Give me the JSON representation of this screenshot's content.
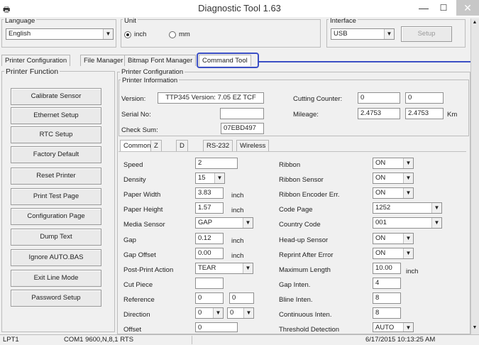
{
  "window": {
    "title": "Diagnostic Tool 1.63",
    "minimize": "—",
    "maximize": "☐",
    "close": "✕",
    "icon": "printer-icon"
  },
  "language": {
    "label": "Language",
    "value": "English"
  },
  "unit": {
    "label": "Unit",
    "options": [
      "inch",
      "mm"
    ],
    "selected": "inch"
  },
  "interface": {
    "label": "Interface",
    "value": "USB",
    "setup_label": "Setup"
  },
  "main_tabs": [
    "Printer Configuration",
    "File Manager",
    "Bitmap Font Manager",
    "Command Tool"
  ],
  "printer_function": {
    "label": "Printer Function",
    "buttons": [
      "Calibrate Sensor",
      "Ethernet Setup",
      "RTC Setup",
      "Factory Default",
      "Reset Printer",
      "Print Test Page",
      "Configuration Page",
      "Dump Text",
      "Ignore AUTO.BAS",
      "Exit Line Mode",
      "Password Setup"
    ]
  },
  "printer_configuration": {
    "label": "Printer Configuration",
    "info_label": "Printer Information",
    "version_label": "Version:",
    "version": "TTP345 Version: 7.05 EZ TCF",
    "serial_label": "Serial No:",
    "serial": "",
    "checksum_label": "Check Sum:",
    "checksum": "07EBD497",
    "cutting_counter_label": "Cutting Counter:",
    "cutting_counter": [
      "0",
      "0"
    ],
    "mileage_label": "Mileage:",
    "mileage": [
      "2.4753",
      "2.4753"
    ],
    "mileage_unit": "Km"
  },
  "sub_tabs": [
    "Common",
    "Z",
    "D",
    "RS-232",
    "Wireless"
  ],
  "common": {
    "speed": {
      "label": "Speed",
      "value": "2"
    },
    "density": {
      "label": "Density",
      "value": "15"
    },
    "paper_width": {
      "label": "Paper Width",
      "value": "3.83",
      "unit": "inch"
    },
    "paper_height": {
      "label": "Paper Height",
      "value": "1.57",
      "unit": "inch"
    },
    "media_sensor": {
      "label": "Media Sensor",
      "value": "GAP"
    },
    "gap": {
      "label": "Gap",
      "value": "0.12",
      "unit": "inch"
    },
    "gap_offset": {
      "label": "Gap Offset",
      "value": "0.00",
      "unit": "inch"
    },
    "post_print_action": {
      "label": "Post-Print Action",
      "value": "TEAR"
    },
    "cut_piece": {
      "label": "Cut Piece",
      "value": ""
    },
    "reference": {
      "label": "Reference",
      "x": "0",
      "y": "0"
    },
    "direction": {
      "label": "Direction",
      "a": "0",
      "b": "0"
    },
    "offset": {
      "label": "Offset",
      "value": "0"
    },
    "ribbon": {
      "label": "Ribbon",
      "value": "ON"
    },
    "ribbon_sensor": {
      "label": "Ribbon Sensor",
      "value": "ON"
    },
    "ribbon_encoder_err": {
      "label": "Ribbon Encoder Err.",
      "value": "ON"
    },
    "code_page": {
      "label": "Code Page",
      "value": "1252"
    },
    "country_code": {
      "label": "Country Code",
      "value": "001"
    },
    "head_up_sensor": {
      "label": "Head-up Sensor",
      "value": "ON"
    },
    "reprint_after_error": {
      "label": "Reprint After Error",
      "value": "ON"
    },
    "maximum_length": {
      "label": "Maximum Length",
      "value": "10.00",
      "unit": "inch"
    },
    "gap_inten": {
      "label": "Gap Inten.",
      "value": "4"
    },
    "bline_inten": {
      "label": "Bline Inten.",
      "value": "8"
    },
    "continuous_inten": {
      "label": "Continuous Inten.",
      "value": "8"
    },
    "threshold_detection": {
      "label": "Threshold Detection",
      "value": "AUTO"
    }
  },
  "status": {
    "port": "LPT1",
    "com": "COM1 9600,N,8,1 RTS",
    "datetime": "6/17/2015 10:13:25 AM"
  },
  "highlight_color": "#3b4fc4"
}
